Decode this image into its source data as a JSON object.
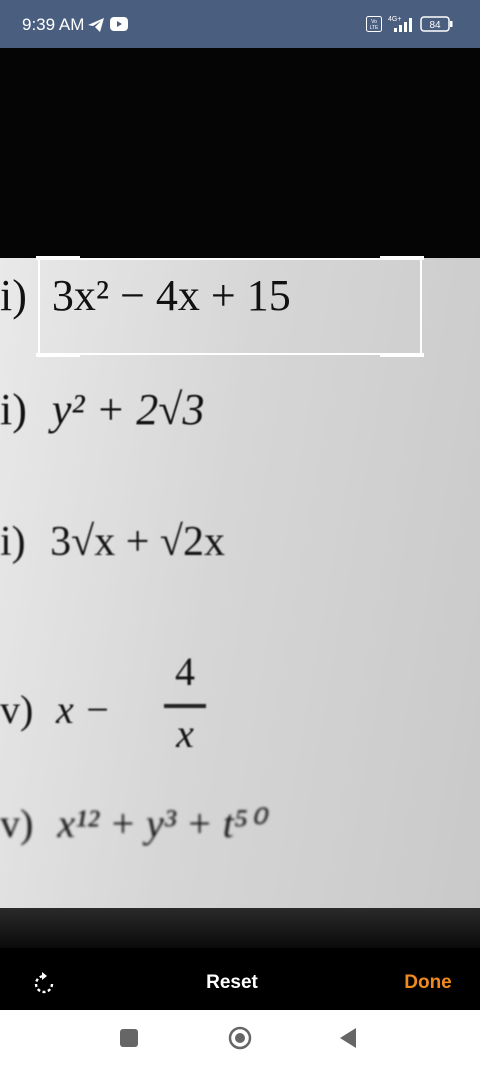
{
  "status_bar": {
    "time": "9:39 AM",
    "network": "4G+",
    "volte": "Vo LTE",
    "battery": "84"
  },
  "expressions": {
    "e1": {
      "label": "i)",
      "text": "3x² − 4x + 15"
    },
    "e2": {
      "label": "i)",
      "text": "y² + 2√3"
    },
    "e3": {
      "label": "i)",
      "text": "3√x  +  √2x"
    },
    "e4": {
      "label": "v)",
      "lhs": "x −",
      "numerator": "4",
      "denominator": "x"
    },
    "e5": {
      "label": "v)",
      "text": "x¹² + y³ + t⁵⁰"
    }
  },
  "actions": {
    "rotate_icon": "rotate-icon",
    "reset_label": "Reset",
    "done_label": "Done",
    "done_color": "#ef8a1e"
  },
  "nav": {
    "recents_icon": "square-icon",
    "home_icon": "circle-icon",
    "back_icon": "triangle-back-icon"
  }
}
